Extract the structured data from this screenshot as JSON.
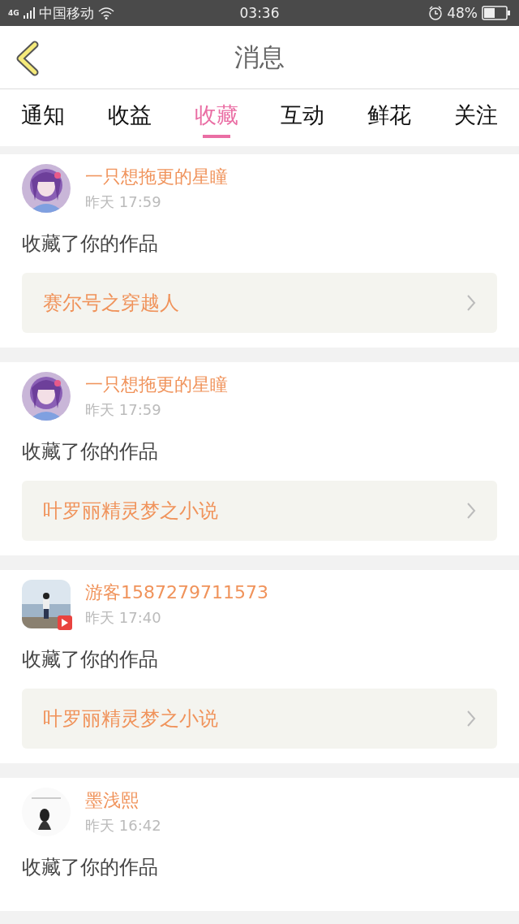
{
  "status_bar": {
    "network": "4G",
    "carrier": "中国移动",
    "time": "03:36",
    "battery": "48%"
  },
  "header": {
    "title": "消息"
  },
  "tabs": [
    {
      "label": "通知",
      "selected": false
    },
    {
      "label": "收益",
      "selected": false
    },
    {
      "label": "收藏",
      "selected": true
    },
    {
      "label": "互动",
      "selected": false
    },
    {
      "label": "鲜花",
      "selected": false
    },
    {
      "label": "关注",
      "selected": false
    }
  ],
  "messages": [
    {
      "name": "一只想拖更的星瞳",
      "time": "昨天 17:59",
      "action": "收藏了你的作品",
      "work": "赛尔号之穿越人"
    },
    {
      "name": "一只想拖更的星瞳",
      "time": "昨天 17:59",
      "action": "收藏了你的作品",
      "work": "叶罗丽精灵梦之小说"
    },
    {
      "badge": true,
      "name": "游客1587279711573",
      "time": "昨天 17:40",
      "action": "收藏了你的作品",
      "work": "叶罗丽精灵梦之小说"
    },
    {
      "name": "墨浅熙",
      "time": "昨天 16:42",
      "action": "收藏了你的作品"
    }
  ]
}
